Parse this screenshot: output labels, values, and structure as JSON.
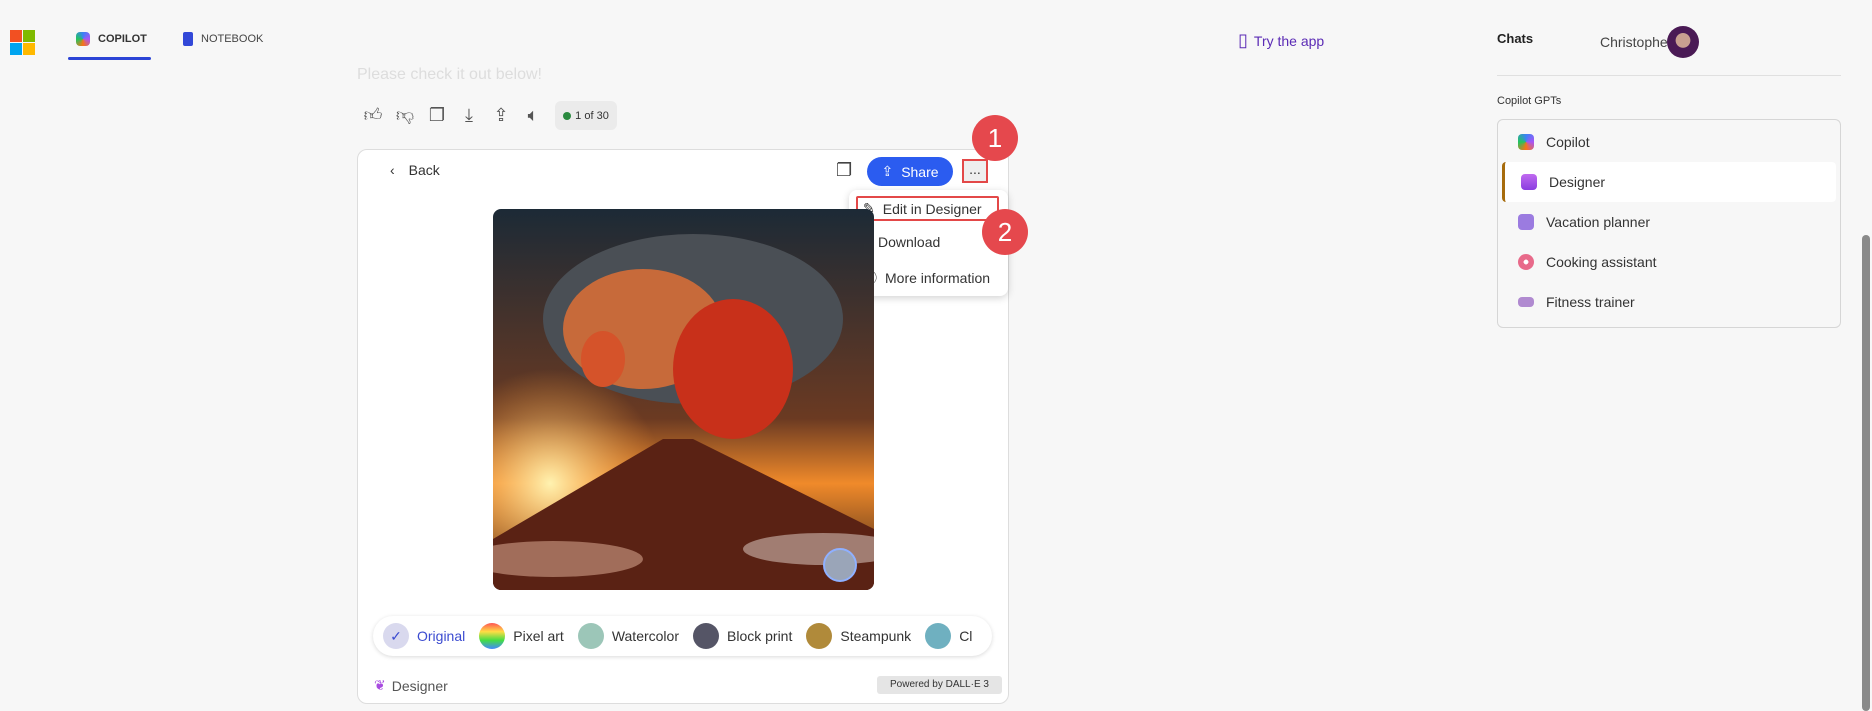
{
  "nav": {
    "tabs": [
      {
        "label": "COPILOT",
        "icon": "copilot-icon",
        "active": true
      },
      {
        "label": "NOTEBOOK",
        "icon": "notebook-icon"
      }
    ],
    "try_app": "Try the app"
  },
  "message": {
    "text": "Please check it out below!",
    "counter": "1 of 30",
    "actions": [
      "thumbs-up-icon",
      "thumbs-down-icon",
      "copy-icon",
      "download-icon",
      "share-icon",
      "speaker-icon"
    ]
  },
  "viewer": {
    "back": "Back",
    "share": "Share",
    "more": "...",
    "menu": [
      {
        "label": "Edit in Designer",
        "icon": "pencil-icon"
      },
      {
        "label": "Download",
        "icon": "download-icon"
      },
      {
        "label": "More information",
        "icon": "info-icon"
      }
    ],
    "badges": [
      "1",
      "2"
    ],
    "styles": [
      {
        "label": "Original",
        "selected": true
      },
      {
        "label": "Pixel art"
      },
      {
        "label": "Watercolor"
      },
      {
        "label": "Block print"
      },
      {
        "label": "Steampunk"
      },
      {
        "label": "Cl"
      }
    ],
    "footer_brand": "Designer",
    "powered": "Powered by DALL·E 3"
  },
  "sidebar": {
    "title": "Chats",
    "user": "Christophe...",
    "section": "Copilot GPTs",
    "items": [
      {
        "label": "Copilot"
      },
      {
        "label": "Designer",
        "selected": true
      },
      {
        "label": "Vacation planner"
      },
      {
        "label": "Cooking assistant"
      },
      {
        "label": "Fitness trainer"
      }
    ]
  },
  "colors": {
    "accent": "#2b5cf0",
    "highlight": "#e34848",
    "selected_bar": "#a66b0c",
    "try_app": "#5b2bb5"
  }
}
